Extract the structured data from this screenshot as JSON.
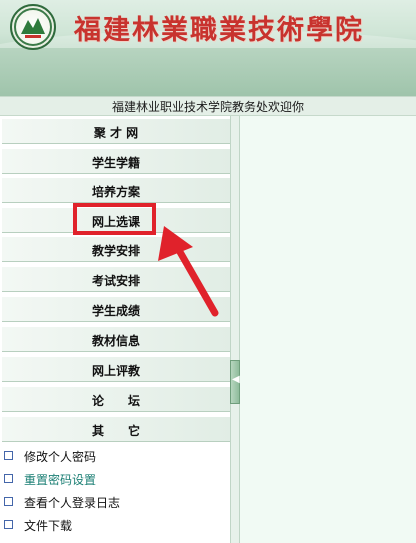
{
  "header": {
    "school_name": "福建林業職業技術學院"
  },
  "welcome": {
    "text": "福建林业职业技术学院教务处欢迎你"
  },
  "menu": {
    "items": [
      {
        "label": "聚 才 网"
      },
      {
        "label": "学生学籍"
      },
      {
        "label": "培养方案"
      },
      {
        "label": "网上选课"
      },
      {
        "label": "教学安排"
      },
      {
        "label": "考试安排"
      },
      {
        "label": "学生成绩"
      },
      {
        "label": "教材信息"
      },
      {
        "label": "网上评教"
      },
      {
        "label": "论　　坛"
      },
      {
        "label": "其　　它"
      }
    ],
    "highlighted_index": 3
  },
  "sublinks": {
    "items": [
      {
        "label": "修改个人密码"
      },
      {
        "label": "重置密码设置"
      },
      {
        "label": "查看个人登录日志"
      },
      {
        "label": "文件下载"
      }
    ]
  },
  "splitter": {
    "handle_icon": "◀"
  },
  "colors": {
    "highlight": "#e0222b",
    "title": "#c8332e",
    "content_bg": "#f1faf4"
  }
}
